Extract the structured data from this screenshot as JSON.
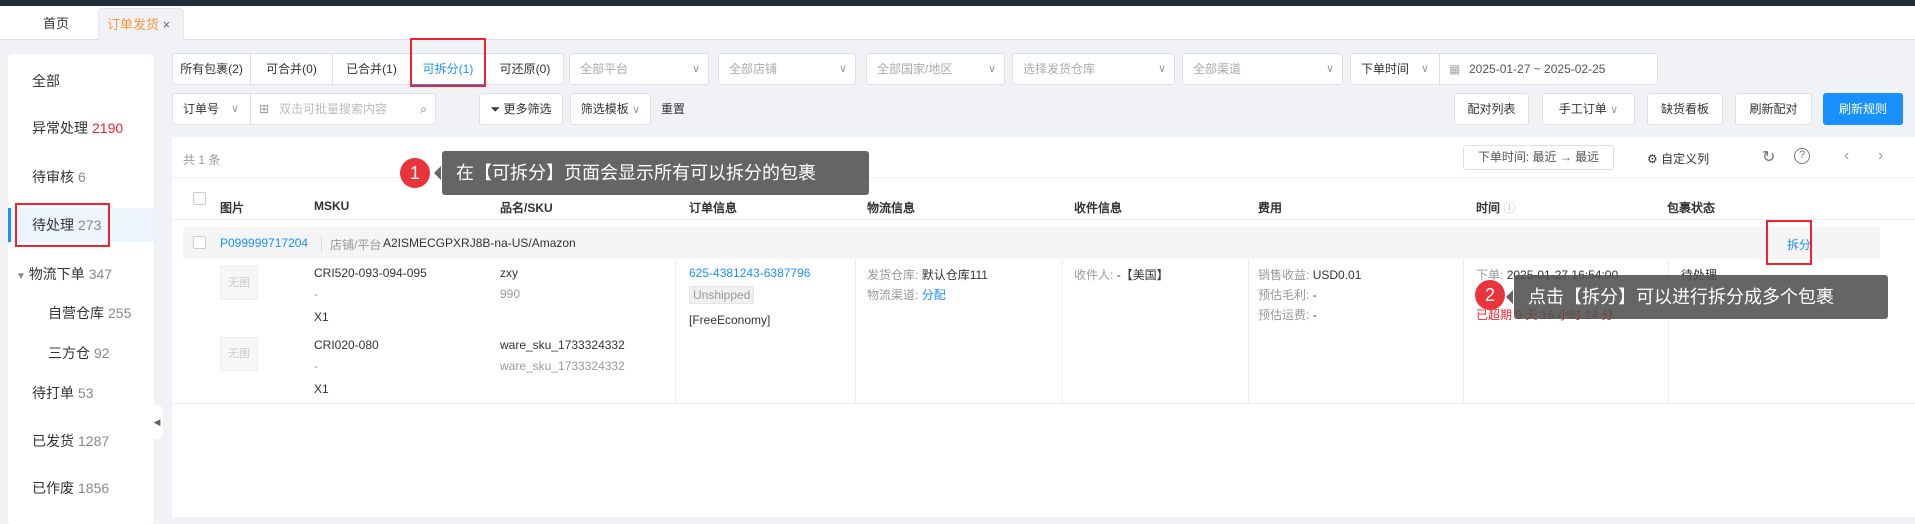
{
  "tabs": {
    "home": "首页",
    "active": "订单发货",
    "close": "×"
  },
  "sidebar": [
    {
      "label": "全部",
      "count": ""
    },
    {
      "label": "异常处理",
      "count": "2190"
    },
    {
      "label": "待审核",
      "count": "6"
    },
    {
      "label": "待处理",
      "count": "273"
    },
    {
      "label": "物流下单",
      "count": "347"
    },
    {
      "label": "自营仓库",
      "count": "255"
    },
    {
      "label": "三方仓",
      "count": "92"
    },
    {
      "label": "待打单",
      "count": "53"
    },
    {
      "label": "已发货",
      "count": "1287"
    },
    {
      "label": "已作废",
      "count": "1856"
    }
  ],
  "filters": {
    "segments": [
      "所有包裹(2)",
      "可合并(0)",
      "已合并(1)",
      "可拆分(1)",
      "可还原(0)"
    ],
    "platform": "全部平台",
    "shop": "全部店铺",
    "country": "全部国家/地区",
    "warehouse": "选择发货仓库",
    "channel": "全部渠道",
    "time_type": "下单时间",
    "date_range": "2025-01-27 ~ 2025-02-25",
    "search_type": "订单号",
    "search_placeholder": "双击可批量搜索内容",
    "more": "更多筛选",
    "template": "筛选模板",
    "reset": "重置"
  },
  "actions": {
    "match_list": "配对列表",
    "manual_order": "手工订单",
    "stock_board": "缺货看板",
    "refresh_match": "刷新配对",
    "refresh_rules": "刷新规则"
  },
  "toolbar": {
    "total": "共 1 条",
    "sort": "下单时间:  最近 → 最远",
    "custom_cols": "自定义列"
  },
  "columns": [
    "图片",
    "MSKU",
    "品名/SKU",
    "订单信息",
    "物流信息",
    "收件信息",
    "费用",
    "时间",
    "包裹状态"
  ],
  "order": {
    "package_id": "P099999717204",
    "shop_label": "店铺/平台",
    "shop": "A2ISMECGPXRJ8B-na-US/Amazon",
    "split": "拆分",
    "items": [
      {
        "img": "无图",
        "msku": "CRI520-093-094-095",
        "dash": "-",
        "qty": "X1",
        "name": "zxy",
        "sku": "990"
      },
      {
        "img": "无图",
        "msku": "CRI020-080",
        "dash": "-",
        "qty": "X1",
        "name": "ware_sku_1733324332",
        "sku": "ware_sku_1733324332"
      }
    ],
    "order_no": "625-4381243-6387796",
    "order_status": "Unshipped",
    "shipping": "[FreeEconomy]",
    "warehouse_label": "发货仓库:",
    "warehouse": "默认仓库111",
    "channel_label": "物流渠道:",
    "channel": "分配",
    "recipient_label": "收件人:",
    "recipient": "-【美国】",
    "revenue_label": "销售收益:",
    "revenue": "USD0.01",
    "profit_label": "预估毛利:",
    "profit": "-",
    "freight_label": "预估运费:",
    "freight": "-",
    "order_time_label": "下单:",
    "order_time": "2025-01-27 16:54:00",
    "overdue": "已超期 9 天 16 小时 14 分",
    "status": "待处理"
  },
  "tips": [
    {
      "n": "1",
      "text": "在【可拆分】页面会显示所有可以拆分的包裹"
    },
    {
      "n": "2",
      "text": "点击【拆分】可以进行拆分成多个包裹"
    }
  ]
}
